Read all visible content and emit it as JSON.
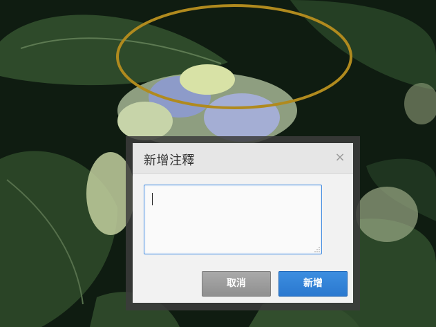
{
  "dialog": {
    "title": "新增注釋",
    "close_glyph": "×",
    "textarea": {
      "value": "",
      "placeholder": ""
    },
    "buttons": {
      "cancel_label": "取消",
      "add_label": "新增"
    }
  },
  "annotation": {
    "shape": "ellipse",
    "color": "#b08a1e"
  },
  "colors": {
    "primary_button": "#2f7fd6",
    "secondary_button": "#9a9a9a",
    "textarea_focus_border": "#4a90e2"
  },
  "icons": [
    "close-icon",
    "resize-grip-icon"
  ]
}
